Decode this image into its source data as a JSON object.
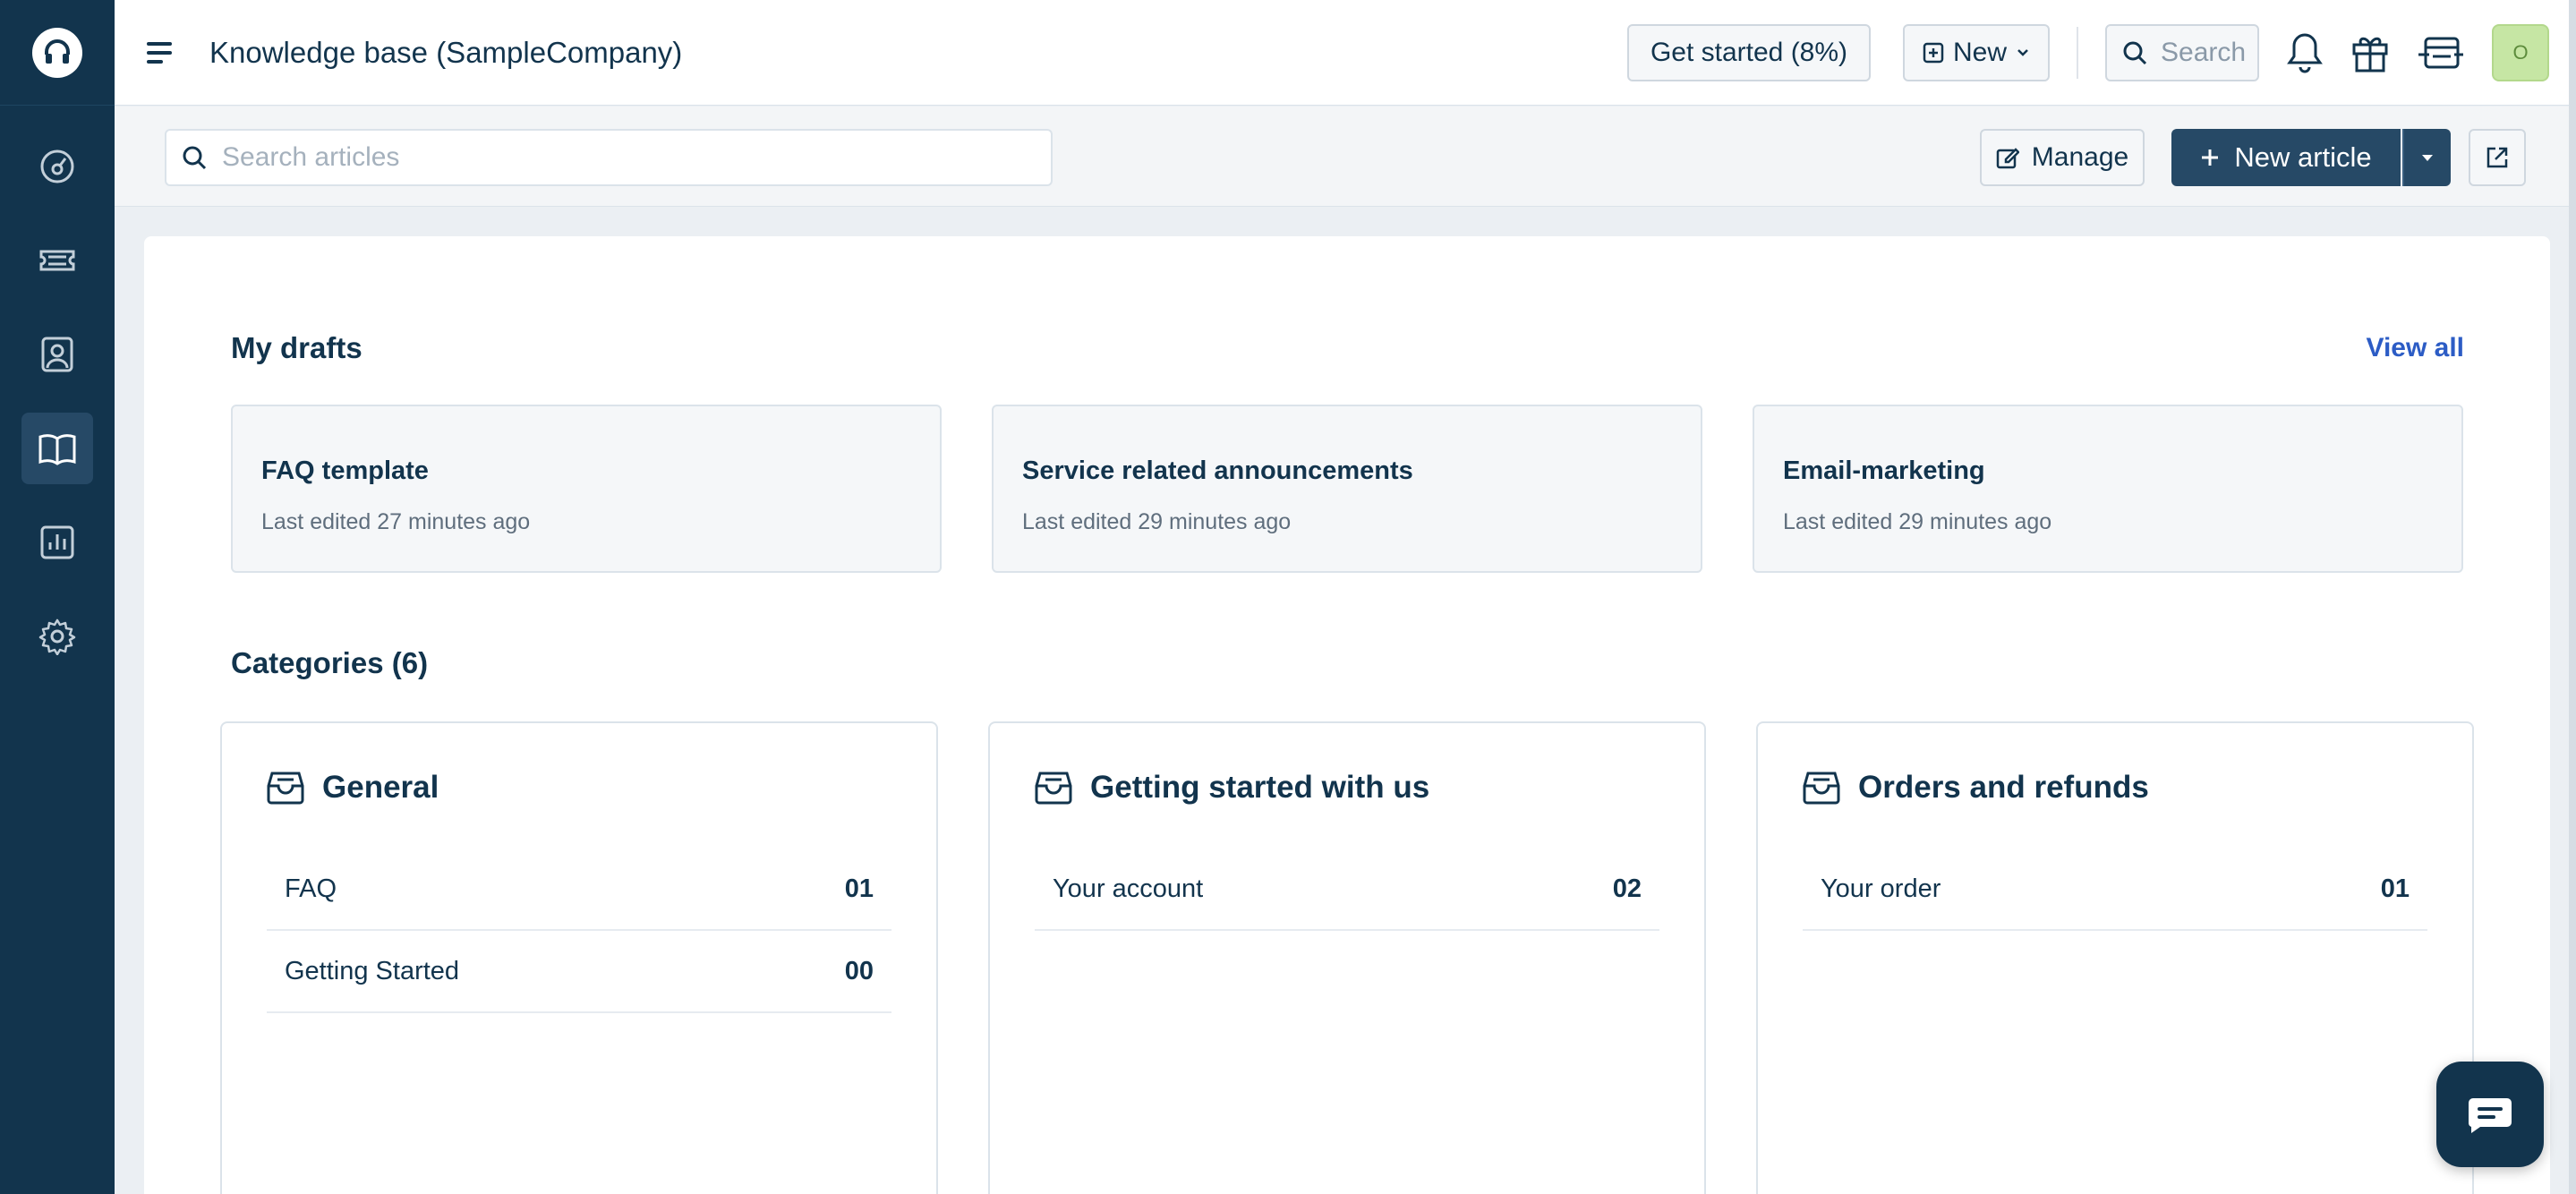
{
  "sidebar": {
    "logo_icon": "headset-icon",
    "items": [
      {
        "icon": "dashboard-icon",
        "active": false
      },
      {
        "icon": "ticket-icon",
        "active": false
      },
      {
        "icon": "contacts-icon",
        "active": false
      },
      {
        "icon": "book-icon",
        "active": true
      },
      {
        "icon": "reports-icon",
        "active": false
      },
      {
        "icon": "gear-icon",
        "active": false
      }
    ]
  },
  "header": {
    "title": "Knowledge base (SampleCompany)",
    "get_started_label": "Get started (8%)",
    "new_label": "New",
    "search_placeholder": "Search",
    "avatar_initial": "O"
  },
  "toolbar": {
    "search_placeholder": "Search articles",
    "manage_label": "Manage",
    "new_article_label": "New article"
  },
  "drafts": {
    "title": "My drafts",
    "view_all_label": "View all",
    "items": [
      {
        "title": "FAQ template",
        "meta": "Last edited 27 minutes ago"
      },
      {
        "title": "Service related announcements",
        "meta": "Last edited 29 minutes ago"
      },
      {
        "title": "Email-marketing",
        "meta": "Last edited 29 minutes ago"
      }
    ]
  },
  "categories": {
    "title": "Categories (6)",
    "items": [
      {
        "name": "General",
        "folders": [
          {
            "label": "FAQ",
            "count": "01"
          },
          {
            "label": "Getting Started",
            "count": "00"
          }
        ]
      },
      {
        "name": "Getting started with us",
        "folders": [
          {
            "label": "Your account",
            "count": "02"
          }
        ]
      },
      {
        "name": "Orders and refunds",
        "folders": [
          {
            "label": "Your order",
            "count": "01"
          }
        ]
      }
    ]
  },
  "colors": {
    "sidebar_bg": "#12344d",
    "primary_button": "#264966",
    "link": "#2c5cc5",
    "avatar_bg": "#c6e6a4"
  }
}
